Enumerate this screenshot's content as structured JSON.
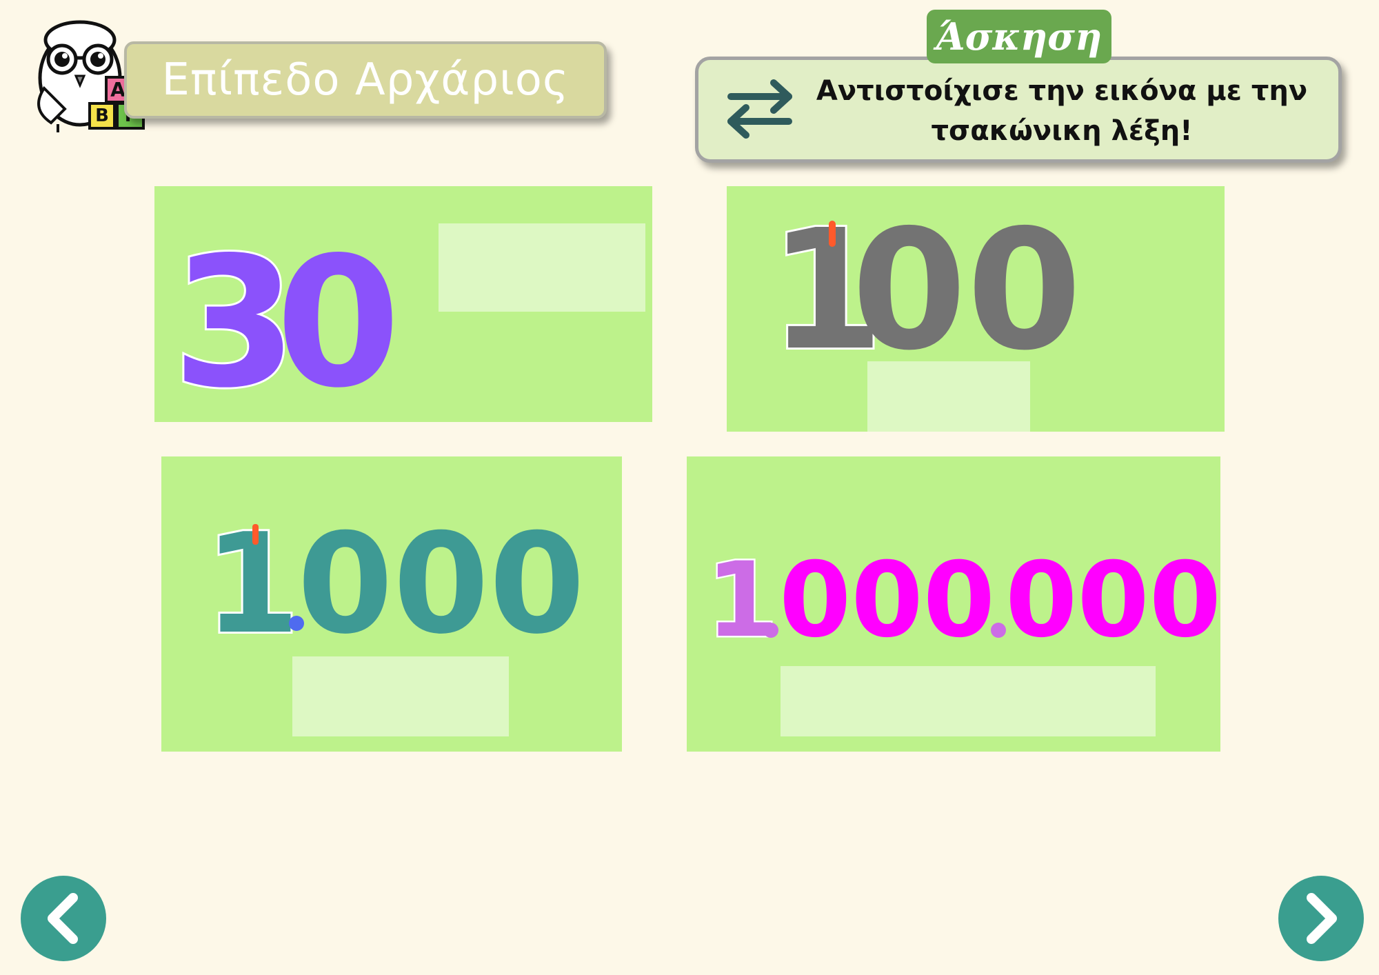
{
  "header": {
    "level_label": "Επίπεδο Αρχάριος",
    "owl_blocks": [
      "Α",
      "Β",
      "Γ"
    ]
  },
  "exercise": {
    "tag": "Άσκηση",
    "instruction_line1": "Αντιστοίχισε την εικόνα με την",
    "instruction_line2": "τσακώνικη λέξη!",
    "icon": "swap-arrows-icon"
  },
  "cards": [
    {
      "number_parts": [
        "3",
        "0"
      ],
      "drop_value": ""
    },
    {
      "number_parts": [
        "1",
        "00"
      ],
      "drop_value": ""
    },
    {
      "number_parts": [
        "1",
        "000"
      ],
      "drop_value": ""
    },
    {
      "number_parts": [
        "1",
        "000",
        "000"
      ],
      "drop_value": ""
    }
  ],
  "navigation": {
    "prev_icon": "chevron-left-icon",
    "next_icon": "chevron-right-icon"
  },
  "colors": {
    "background": "#fdf8e8",
    "card": "#bdf28b",
    "drop_zone": "#ddf8c3",
    "purple": "#8b52fb",
    "gray": "#737373",
    "teal": "#3e9a94",
    "magenta": "#ff00ff",
    "lilac": "#cc6ce6",
    "accent_orange": "#ff5a2b",
    "nav": "#3a9e8f",
    "tag_green": "#6aa84f"
  }
}
